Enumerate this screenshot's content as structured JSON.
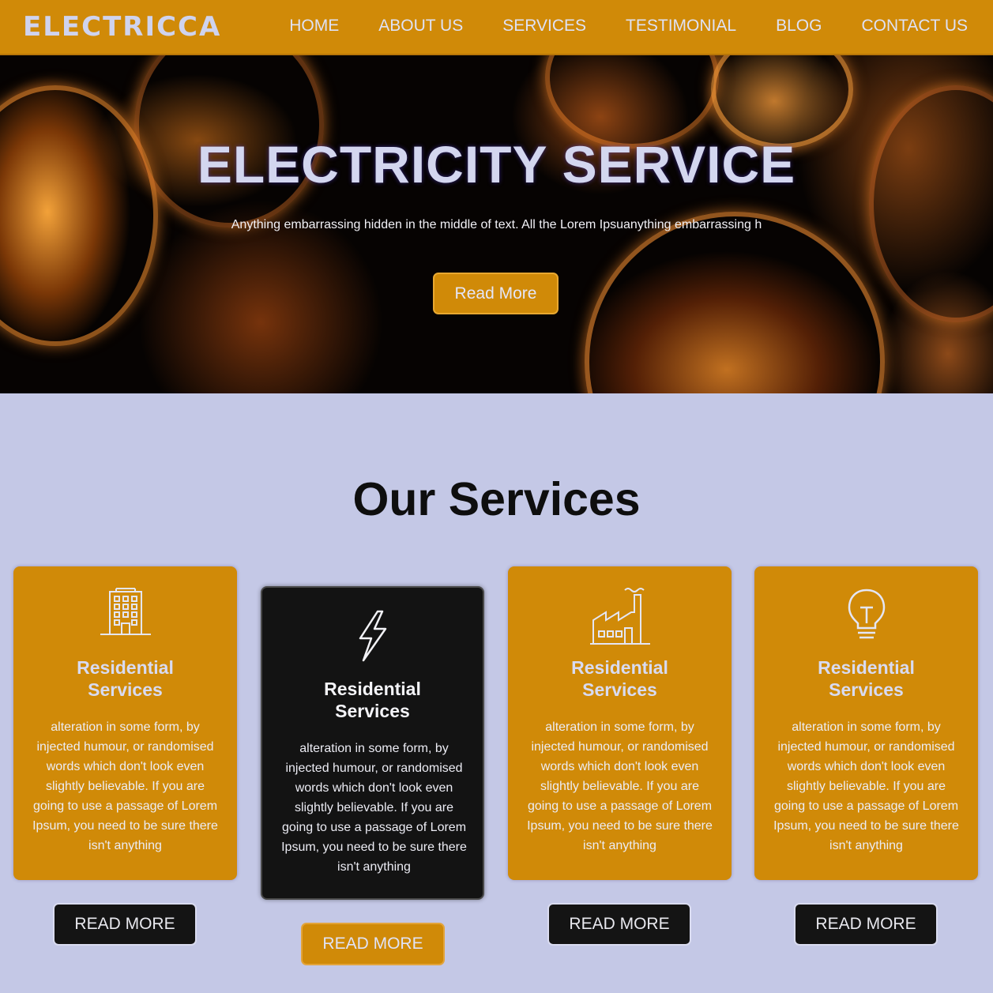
{
  "brand": {
    "logo_text": "ELECTRICCA"
  },
  "nav": {
    "items": [
      {
        "label": "HOME"
      },
      {
        "label": "ABOUT US"
      },
      {
        "label": "SERVICES"
      },
      {
        "label": "TESTIMONIAL"
      },
      {
        "label": "BLOG"
      },
      {
        "label": "CONTACT US"
      }
    ]
  },
  "hero": {
    "title": "ELECTRICITY SERVICE",
    "text": "Anything embarrassing hidden in the middle of text. All the Lorem Ipsuanything embarrassing h",
    "button_label": "Read More"
  },
  "services": {
    "title": "Our Services",
    "cards": [
      {
        "icon": "building-icon",
        "title_line1": "Residential",
        "title_line2": "Services",
        "text": "alteration in some form, by injected humour, or randomised words which don't look even slightly believable. If you are going to use a passage of Lorem Ipsum, you need to be sure there isn't anything",
        "button_label": "READ MORE"
      },
      {
        "icon": "lightning-icon",
        "title_line1": "Residential",
        "title_line2": "Services",
        "text": "alteration in some form, by injected humour, or randomised words which don't look even slightly believable. If you are going to use a passage of Lorem Ipsum, you need to be sure there isn't anything",
        "button_label": "READ MORE"
      },
      {
        "icon": "factory-icon",
        "title_line1": "Residential",
        "title_line2": "Services",
        "text": "alteration in some form, by injected humour, or randomised words which don't look even slightly believable. If you are going to use a passage of Lorem Ipsum, you need to be sure there isn't anything",
        "button_label": "READ MORE"
      },
      {
        "icon": "lightbulb-icon",
        "title_line1": "Residential",
        "title_line2": "Services",
        "text": "alteration in some form, by injected humour, or randomised words which don't look even slightly believable. If you are going to use a passage of Lorem Ipsum, you need to be sure there isn't anything",
        "button_label": "READ MORE"
      }
    ]
  },
  "colors": {
    "accent_orange": "#d08a08",
    "page_background": "#c4c8e6",
    "dark_card": "#131313"
  }
}
